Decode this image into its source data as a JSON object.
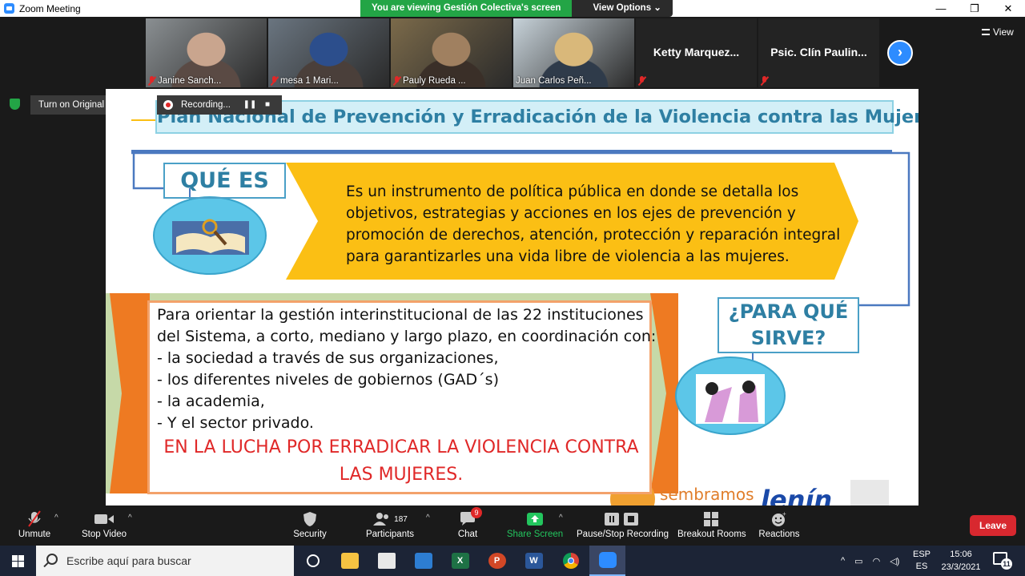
{
  "window": {
    "title": "Zoom Meeting",
    "controls": [
      "—",
      "❐",
      "✕"
    ]
  },
  "share_banner": {
    "viewing": "You are viewing Gestión Colectiva's screen",
    "options": "View Options ⌄"
  },
  "view_button": "View",
  "participants_strip": [
    {
      "name": "Janine Sanch...",
      "muted": true,
      "video": true,
      "palette": [
        "#8a8f92",
        "#5a4a44",
        "#c9a58e"
      ]
    },
    {
      "name": "mesa 1 Mari...",
      "muted": true,
      "video": true,
      "palette": [
        "#6a7580",
        "#4a3f3a",
        "#2c4e8c"
      ]
    },
    {
      "name": "Pauly Rueda ...",
      "muted": true,
      "video": true,
      "palette": [
        "#7b6a4a",
        "#3a2f28",
        "#a08060"
      ]
    },
    {
      "name": "Juan Carlos Peñ...",
      "muted": false,
      "video": true,
      "active": true,
      "palette": [
        "#c7d2d9",
        "#2f3b4a",
        "#d9b87a"
      ]
    },
    {
      "name": "Ketty  Marquez...",
      "muted": true,
      "video": false
    },
    {
      "name": "Psic. Clín Paulin...",
      "muted": true,
      "video": false
    }
  ],
  "next_page_icon": "chevron-right-icon",
  "original_sound": {
    "label": "Turn on Original Sound",
    "caret": "▾"
  },
  "recording": {
    "label": "Recording...",
    "pause": "❚❚",
    "stop": "■"
  },
  "slide": {
    "title": "Plan Nacional de Prevención y Erradicación de la Violencia contra las Mujeres",
    "que_es": "QUÉ ES",
    "definition": "Es un instrumento de política pública en donde se detalla los objetivos, estrategias y acciones en los ejes de prevención y promoción de derechos, atención, protección y reparación integral para garantizarles una vida libre de violencia a las mujeres.",
    "body_lines": [
      "Para orientar la gestión interinstitucional de las 22 instituciones",
      "del Sistema, a corto, mediano y largo plazo, en coordinación con:",
      "-     la sociedad a través de sus organizaciones,",
      "-     los diferentes niveles de gobiernos (GAD´s)",
      "-     la academia,",
      "-   Y  el sector privado."
    ],
    "highlight": "EN LA LUCHA POR ERRADICAR LA VIOLENCIA CONTRA LAS MUJERES.",
    "para_que": "¿PARA QUÉ SIRVE?",
    "footer_logo_1": "sembramos",
    "footer_logo_2": "lenín",
    "colors": {
      "arrow_yellow": "#fbbf14",
      "arrow_orange": "#ee7a22",
      "box_border": "#f3a26b",
      "title_text": "#2e7fa3",
      "red": "#e02828"
    }
  },
  "toolbar": {
    "unmute": "Unmute",
    "stop_video": "Stop Video",
    "security": "Security",
    "participants": "Participants",
    "participants_count": "187",
    "chat": "Chat",
    "chat_badge": "9",
    "share_screen": "Share Screen",
    "pause_stop_recording": "Pause/Stop Recording",
    "breakout_rooms": "Breakout Rooms",
    "reactions": "Reactions",
    "leave": "Leave"
  },
  "taskbar": {
    "search_placeholder": "Escribe aquí para buscar",
    "apps": [
      "cortana-icon",
      "file-explorer-icon",
      "store-icon",
      "mail-icon",
      "excel-icon",
      "powerpoint-icon",
      "word-icon",
      "chrome-icon",
      "zoom-icon"
    ],
    "lang_top": "ESP",
    "lang_bottom": "ES",
    "time": "15:06",
    "date": "23/3/2021",
    "notifications": "11"
  }
}
